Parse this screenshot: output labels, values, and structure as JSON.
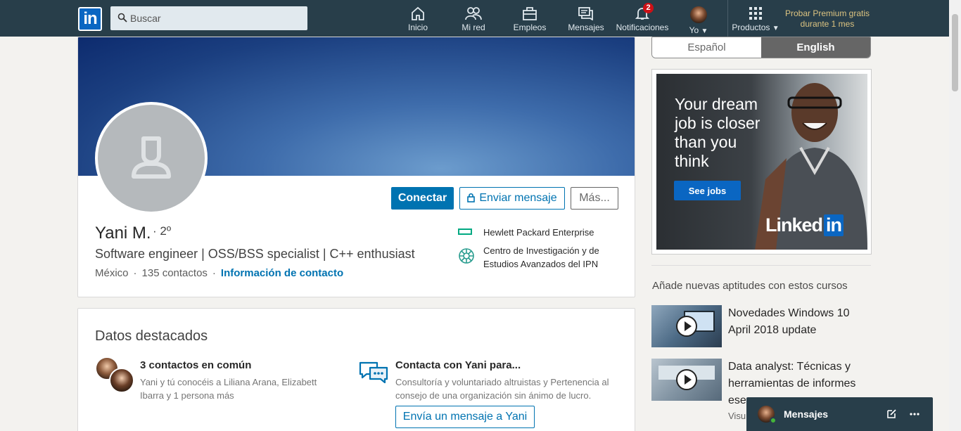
{
  "nav": {
    "logo": "in",
    "search_placeholder": "Buscar",
    "items": [
      {
        "label": "Inicio",
        "icon": "home-icon"
      },
      {
        "label": "Mi red",
        "icon": "network-icon"
      },
      {
        "label": "Empleos",
        "icon": "briefcase-icon"
      },
      {
        "label": "Mensajes",
        "icon": "messages-icon"
      },
      {
        "label": "Notificaciones",
        "icon": "bell-icon",
        "badge": "2"
      },
      {
        "label": "Yo",
        "icon": "profile-avatar"
      },
      {
        "label": "Productos",
        "icon": "grid-icon"
      }
    ],
    "premium": "Probar Premium gratis durante 1 mes"
  },
  "profile": {
    "name": "Yani M.",
    "degree": "· 2º",
    "headline": "Software engineer | OSS/BSS specialist | C++ enthusiast",
    "location": "México",
    "connections": "135 contactos",
    "contact_info": "Información de contacto",
    "actions": {
      "connect": "Conectar",
      "message": "Enviar mensaje",
      "more": "Más..."
    },
    "orgs": [
      {
        "name": "Hewlett Packard Enterprise"
      },
      {
        "name": "Centro de Investigación y de Estudios Avanzados del IPN"
      }
    ]
  },
  "highlights": {
    "title": "Datos destacados",
    "mutual": {
      "title": "3 contactos en común",
      "text": "Yani y tú conocéis a Liliana Arana, Elizabett Ibarra y 1 persona más"
    },
    "contact": {
      "title": "Contacta con Yani para...",
      "text": "Consultoría y voluntariado altruistas y Pertenencia al consejo de una organización sin ánimo de lucro.",
      "button": "Envía un mensaje a Yani"
    }
  },
  "rail": {
    "lang_es": "Español",
    "lang_en": "English",
    "ad": {
      "headline": "Your dream job is closer than you think",
      "button": "See jobs",
      "brand": "Linked",
      "brand_box": "in"
    },
    "courses_title": "Añade nuevas aptitudes con estos cursos",
    "courses": [
      {
        "title": "Novedades Windows 10 April 2018 update"
      },
      {
        "title": "Data analyst: Técnicas y herramientas de informes ese",
        "sub": "Visu"
      }
    ]
  },
  "messaging": {
    "label": "Mensajes"
  },
  "colors": {
    "nav": "#283e4a",
    "primary": "#0073b1",
    "premium": "#dcc380",
    "badge": "#cc1016"
  }
}
